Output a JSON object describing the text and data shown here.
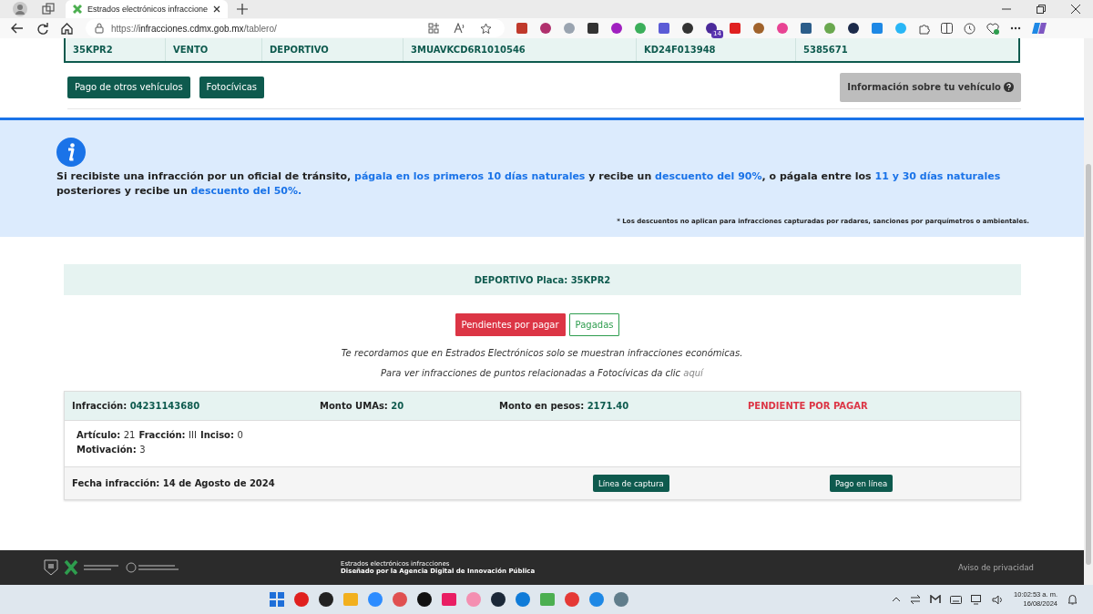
{
  "browser": {
    "tab_title": "Estrados electrónicos infraccione",
    "url_scheme": "https://",
    "url_host": "infracciones.cdmx.gob.mx",
    "url_path": "/tablero/",
    "extension_badge": "14"
  },
  "vehicle_row": [
    "35KPR2",
    "VENTO",
    "DEPORTIVO",
    "3MUAVKCD6R1010546",
    "KD24F013948",
    "5385671"
  ],
  "actions": [
    {
      "label": "Pago de otros vehículos",
      "kind": "primary"
    },
    {
      "label": "Fotocívicas",
      "kind": "primary"
    },
    {
      "label": "Información sobre tu vehículo",
      "kind": "info"
    }
  ],
  "notice": {
    "segments": [
      {
        "text": "Si recibiste una infracción por un oficial de tránsito, ",
        "highlight": false
      },
      {
        "text": "págala en los primeros 10 días naturales",
        "highlight": true
      },
      {
        "text": " y recibe un ",
        "highlight": false
      },
      {
        "text": "descuento del 90%",
        "highlight": true
      },
      {
        "text": ", o págala entre los ",
        "highlight": false
      },
      {
        "text": "11 y 30 días naturales",
        "highlight": true
      },
      {
        "text": " posteriores y recibe un ",
        "highlight": false
      },
      {
        "text": "descuento del 50%.",
        "highlight": true
      }
    ],
    "footnote": "* Los descuentos no aplican para infracciones capturadas por radares, sanciones por parquímetros o ambientales."
  },
  "vehicle_header": "DEPORTIVO Placa: 35KPR2",
  "status_tabs": [
    {
      "label": "Pendientes por pagar",
      "selected": true
    },
    {
      "label": "Pagadas",
      "selected": false
    }
  ],
  "reminder": "Te recordamos que en Estrados Electrónicos solo se muestran infracciones económicas.",
  "points_note": {
    "text": "Para ver infracciones de puntos relacionadas a Fotocívicas da clic ",
    "link": "aquí"
  },
  "infractions": [
    {
      "header": [
        {
          "label": "Infracción:",
          "value": "04231143680"
        },
        {
          "label": "Monto UMAs:",
          "value": "20"
        },
        {
          "label": "Monto en pesos:",
          "value": "2171.40"
        }
      ],
      "status": "PENDIENTE POR PAGAR",
      "pending": true,
      "details": [
        [
          {
            "label": "Artículo:",
            "value": "21"
          },
          {
            "label": "Fracción:",
            "value": "III"
          },
          {
            "label": "Inciso:",
            "value": "0"
          }
        ],
        [
          {
            "label": "Motivación:",
            "value": "3"
          }
        ]
      ],
      "date": "Fecha infracción: 14 de Agosto de 2024",
      "buttons": [
        "Línea de captura",
        "Pago en línea"
      ]
    }
  ],
  "footer": {
    "line1": "Estrados electrónicos infracciones",
    "line2": "Diseñado por la Agencia Digital de Innovación Pública",
    "privacy": "Aviso de privacidad"
  },
  "taskbar": {
    "time": "10:02:53 a. m.",
    "date": "16/08/2024"
  }
}
